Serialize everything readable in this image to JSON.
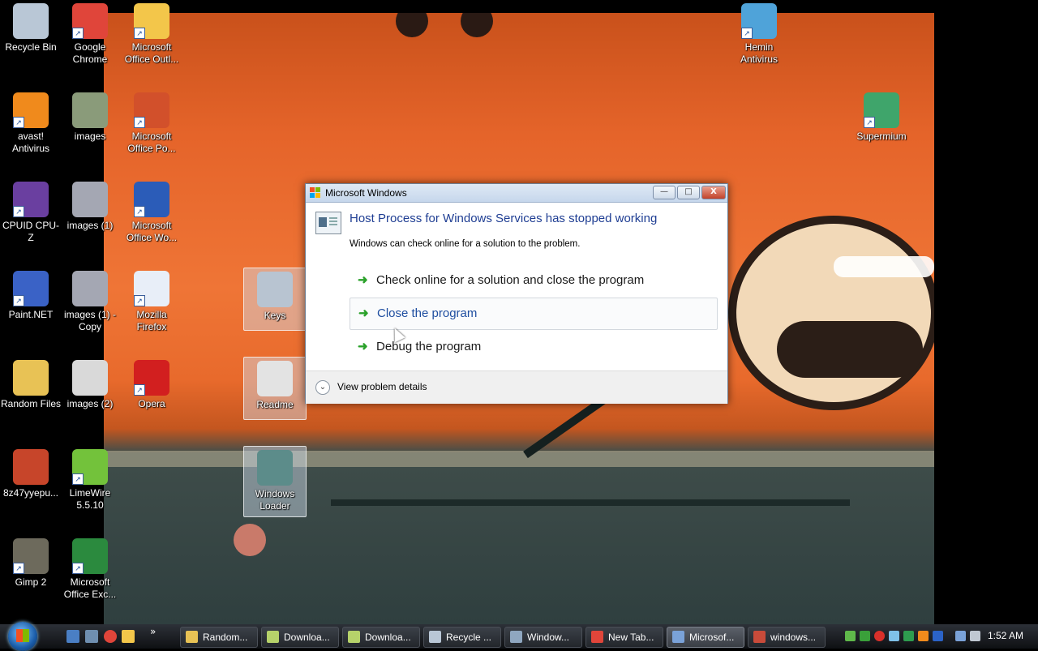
{
  "desktop": {
    "icons": [
      {
        "label": "Recycle Bin",
        "color": "#b9c7d6"
      },
      {
        "label": "Google Chrome",
        "color": "#e0453a"
      },
      {
        "label": "Microsoft Office Outl...",
        "color": "#f3c64a"
      },
      {
        "label": "avast! Antivirus",
        "color": "#f08a1c"
      },
      {
        "label": "images",
        "color": "#8a9b7a"
      },
      {
        "label": "Microsoft Office Po...",
        "color": "#d2502b"
      },
      {
        "label": "CPUID CPU-Z",
        "color": "#6a3fa0"
      },
      {
        "label": "images (1)",
        "color": "#a4a7b3"
      },
      {
        "label": "Microsoft Office Wo...",
        "color": "#2b5cb8"
      },
      {
        "label": "Paint.NET",
        "color": "#3a62c6"
      },
      {
        "label": "images (1) - Copy",
        "color": "#a4a7b3"
      },
      {
        "label": "Mozilla Firefox",
        "color": "#e8eef8"
      },
      {
        "label": "Random Files",
        "color": "#e8c255"
      },
      {
        "label": "images (2)",
        "color": "#d9d9d9"
      },
      {
        "label": "Opera",
        "color": "#d21f1f"
      },
      {
        "label": "8z47yyepu...",
        "color": "#c7452a"
      },
      {
        "label": "LimeWire 5.5.10",
        "color": "#73c23b"
      },
      {
        "label": "Gimp 2",
        "color": "#6d6a5c"
      },
      {
        "label": "Microsoft Office Exc...",
        "color": "#2b8a3e"
      },
      {
        "label": "Keys",
        "color": "#b8c4d1"
      },
      {
        "label": "Readme",
        "color": "#e3e3e3"
      },
      {
        "label": "Windows Loader",
        "color": "#5c8c8a"
      },
      {
        "label": "Hemin Antivirus",
        "color": "#4fa3d9"
      },
      {
        "label": "Supermium",
        "color": "#3fa56b"
      }
    ]
  },
  "dialog": {
    "title": "Microsoft Windows",
    "heading": "Host Process for Windows Services has stopped working",
    "subtext": "Windows can check online for a solution to the problem.",
    "options": [
      {
        "label": "Check online for a solution and close the program"
      },
      {
        "label": "Close the program"
      },
      {
        "label": "Debug the program"
      }
    ],
    "details_label": "View problem details",
    "arrow_glyph": "➜",
    "chevron_glyph": "⌄",
    "min_glyph": "—",
    "max_glyph": "□",
    "close_glyph": "X"
  },
  "taskbar": {
    "tasks": [
      {
        "label": "Random...",
        "color": "#e8c255",
        "active": false
      },
      {
        "label": "Downloa...",
        "color": "#b6d26a",
        "active": false
      },
      {
        "label": "Downloa...",
        "color": "#b6d26a",
        "active": false
      },
      {
        "label": "Recycle ...",
        "color": "#b9c7d6",
        "active": false
      },
      {
        "label": "Window...",
        "color": "#8fa7c0",
        "active": false
      },
      {
        "label": "New Tab...",
        "color": "#e0453a",
        "active": false
      },
      {
        "label": "Microsof...",
        "color": "#7aa2d8",
        "active": true
      },
      {
        "label": "windows...",
        "color": "#c94b3a",
        "active": false
      }
    ],
    "chevron": "»",
    "clock": "1:52 AM"
  },
  "colors": {
    "accent": "#1f3e93",
    "wallpaper_orange": "#ef7536"
  }
}
